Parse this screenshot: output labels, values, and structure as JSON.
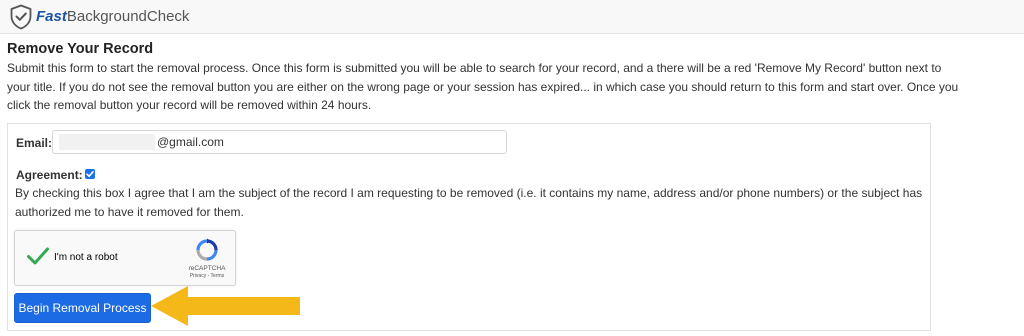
{
  "header": {
    "brand_fast": "Fast",
    "brand_rest": "BackgroundCheck",
    "logo_icon": "shield-check-icon"
  },
  "main": {
    "title": "Remove Your Record",
    "intro": "Submit this form to start the removal process. Once this form is submitted you will be able to search for your record, and a there will be a red 'Remove My Record' button next to your title. If you do not see the removal button you are either on the wrong page or your session has expired... in which case you should return to this form and start over. Once you click the removal button your record will be removed within 24 hours."
  },
  "form": {
    "email_label": "Email:",
    "email_value": "@gmail.com",
    "agreement_label": "Agreement:",
    "agreement_checked": true,
    "agreement_text": "By checking this box I agree that I am the subject of the record I am requesting to be removed (i.e. it contains my name, address and/or phone numbers) or the subject has authorized me to have it removed for them.",
    "recaptcha": {
      "label": "I'm not a robot",
      "brand": "reCAPTCHA",
      "links": "Privacy - Terms",
      "verified": true
    },
    "submit_label": "Begin Removal Process"
  },
  "annotation": {
    "arrow_color": "#f5b819",
    "arrow_icon": "left-arrow-icon"
  },
  "colors": {
    "brand_blue": "#1a54a6",
    "button_blue": "#1d6ae5",
    "check_green": "#34a853"
  }
}
